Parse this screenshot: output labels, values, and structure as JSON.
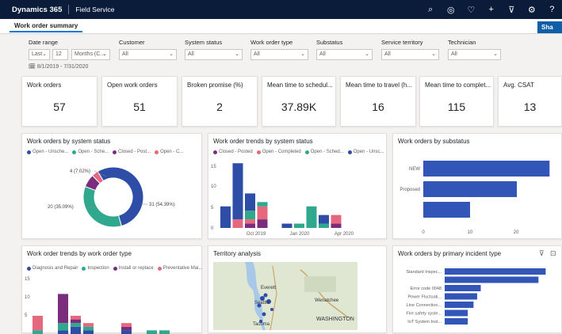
{
  "topbar": {
    "brand": "Dynamics 365",
    "app": "Field Service",
    "icons": [
      "search-icon",
      "target-icon",
      "lightbulb-icon",
      "plus-icon",
      "filter-icon",
      "gear-icon",
      "help-icon"
    ],
    "icon_glyphs": [
      "⌕",
      "◎",
      "♡",
      "+",
      "⊽",
      "⚙",
      "?"
    ]
  },
  "tab": {
    "label": "Work order summary"
  },
  "share_label": "Sha",
  "filters": {
    "date_range": {
      "label": "Date range",
      "period": "Last",
      "count": "12",
      "unit": "Months (C...",
      "range": "8/1/2019 - 7/31/2020"
    },
    "customer": {
      "label": "Customer",
      "value": "All"
    },
    "system_status": {
      "label": "System status",
      "value": "All"
    },
    "work_order_type": {
      "label": "Work order type",
      "value": "All"
    },
    "substatus": {
      "label": "Substatus",
      "value": "All"
    },
    "service_territory": {
      "label": "Service territory",
      "value": "All"
    },
    "technician": {
      "label": "Technician",
      "value": "All"
    }
  },
  "kpis": [
    {
      "title": "Work orders",
      "value": "57"
    },
    {
      "title": "Open work orders",
      "value": "51"
    },
    {
      "title": "Broken promise (%)",
      "value": "2"
    },
    {
      "title": "Mean time to schedul...",
      "value": "37.89K"
    },
    {
      "title": "Mean time to travel (h...",
      "value": "16"
    },
    {
      "title": "Mean time to complet...",
      "value": "115"
    },
    {
      "title": "Avg. CSAT",
      "value": "13"
    }
  ],
  "colors": {
    "blue": "#2e4da7",
    "teal": "#2fa88e",
    "purple": "#7b2d7d",
    "pink": "#e6687e",
    "bar": "#3256b8"
  },
  "charts": {
    "status_donut": {
      "title": "Work orders by system status",
      "legend": [
        "Open - Unsche...",
        "Open - Sche...",
        "Closed - Post...",
        "Open - C..."
      ],
      "labels": [
        "31 (54.39%)",
        "20 (35.09%)",
        "4 (7.02%)"
      ]
    },
    "status_trend": {
      "title": "Work order trends by system status",
      "legend": [
        "Closed - Posted",
        "Open - Completed",
        "Open - Sched...",
        "Open - Unsc..."
      ],
      "yticks": [
        "15",
        "10",
        "5",
        "0"
      ],
      "xticks": [
        "Oct 2019",
        "Jan 2020",
        "Apr 2020"
      ]
    },
    "substatus": {
      "title": "Work orders by substatus",
      "cats": [
        "NEW",
        "Proposed",
        ""
      ],
      "xticks": [
        "0",
        "10",
        "20"
      ]
    },
    "type_trend": {
      "title": "Work order trends by work order type",
      "legend": [
        "Diagnosis and Repair",
        "Inspection",
        "Install or replace",
        "Preventative Mai..."
      ],
      "yticks": [
        "15",
        "10",
        "5"
      ]
    },
    "territory": {
      "title": "Territory analysis",
      "places": [
        "Everett",
        "Seattle",
        "Tacoma",
        "Wenatchee",
        "WASHINGTON"
      ]
    },
    "incident": {
      "title": "Work orders by primary incident type",
      "cats": [
        "Standard Inspec...",
        "",
        "Error code 0048",
        "Power Fluctuati...",
        "Line Connection...",
        "Fire safety syste...",
        "IoT System Inst..."
      ]
    }
  },
  "chart_data": [
    {
      "type": "pie",
      "title": "Work orders by system status",
      "series": [
        {
          "name": "Open - Unscheduled",
          "values": [
            31
          ]
        },
        {
          "name": "Open - Scheduled",
          "values": [
            20
          ]
        },
        {
          "name": "Closed - Posted",
          "values": [
            4
          ]
        },
        {
          "name": "Open - Completed",
          "values": [
            2
          ]
        }
      ]
    },
    {
      "type": "bar",
      "title": "Work order trends by system status",
      "ylim": [
        0,
        15
      ],
      "stacks": [
        [
          0,
          0,
          0,
          5
        ],
        [
          0,
          2,
          0,
          13
        ],
        [
          1,
          1,
          2,
          4
        ],
        [
          2,
          3,
          1,
          0
        ],
        [
          0,
          0,
          0,
          0
        ],
        [
          0,
          0,
          0,
          1
        ],
        [
          0,
          0,
          1,
          0
        ],
        [
          0,
          0,
          5,
          0
        ],
        [
          0,
          0,
          1,
          2
        ],
        [
          1,
          2,
          0,
          0
        ]
      ]
    },
    {
      "type": "bar",
      "title": "Work orders by substatus",
      "categories": [
        "NEW",
        "Proposed",
        ""
      ],
      "values": [
        27,
        20,
        10
      ],
      "xlim": [
        0,
        28
      ]
    },
    {
      "type": "bar",
      "title": "Work order trends by work order type",
      "ylim": [
        0,
        15
      ],
      "stacks": [
        [
          0,
          1,
          0,
          4
        ],
        [
          0,
          0,
          0,
          0
        ],
        [
          1,
          2,
          8,
          0
        ],
        [
          2,
          1,
          1,
          1
        ],
        [
          1,
          1,
          0,
          1
        ],
        [
          0,
          0,
          0,
          0
        ],
        [
          0,
          0,
          0,
          0
        ],
        [
          1,
          0,
          1,
          1
        ],
        [
          0,
          0,
          0,
          0
        ],
        [
          0,
          1,
          0,
          0
        ],
        [
          0,
          1,
          0,
          0
        ]
      ]
    },
    {
      "type": "bar",
      "title": "Work orders by primary incident type",
      "categories": [
        "Standard Inspec...",
        "",
        "Error code 0048",
        "Power Fluctuati...",
        "Line Connection...",
        "Fire safety syste...",
        "IoT System Inst..."
      ],
      "values": [
        14,
        13,
        5,
        4.5,
        4,
        3.2,
        3.2
      ]
    }
  ]
}
